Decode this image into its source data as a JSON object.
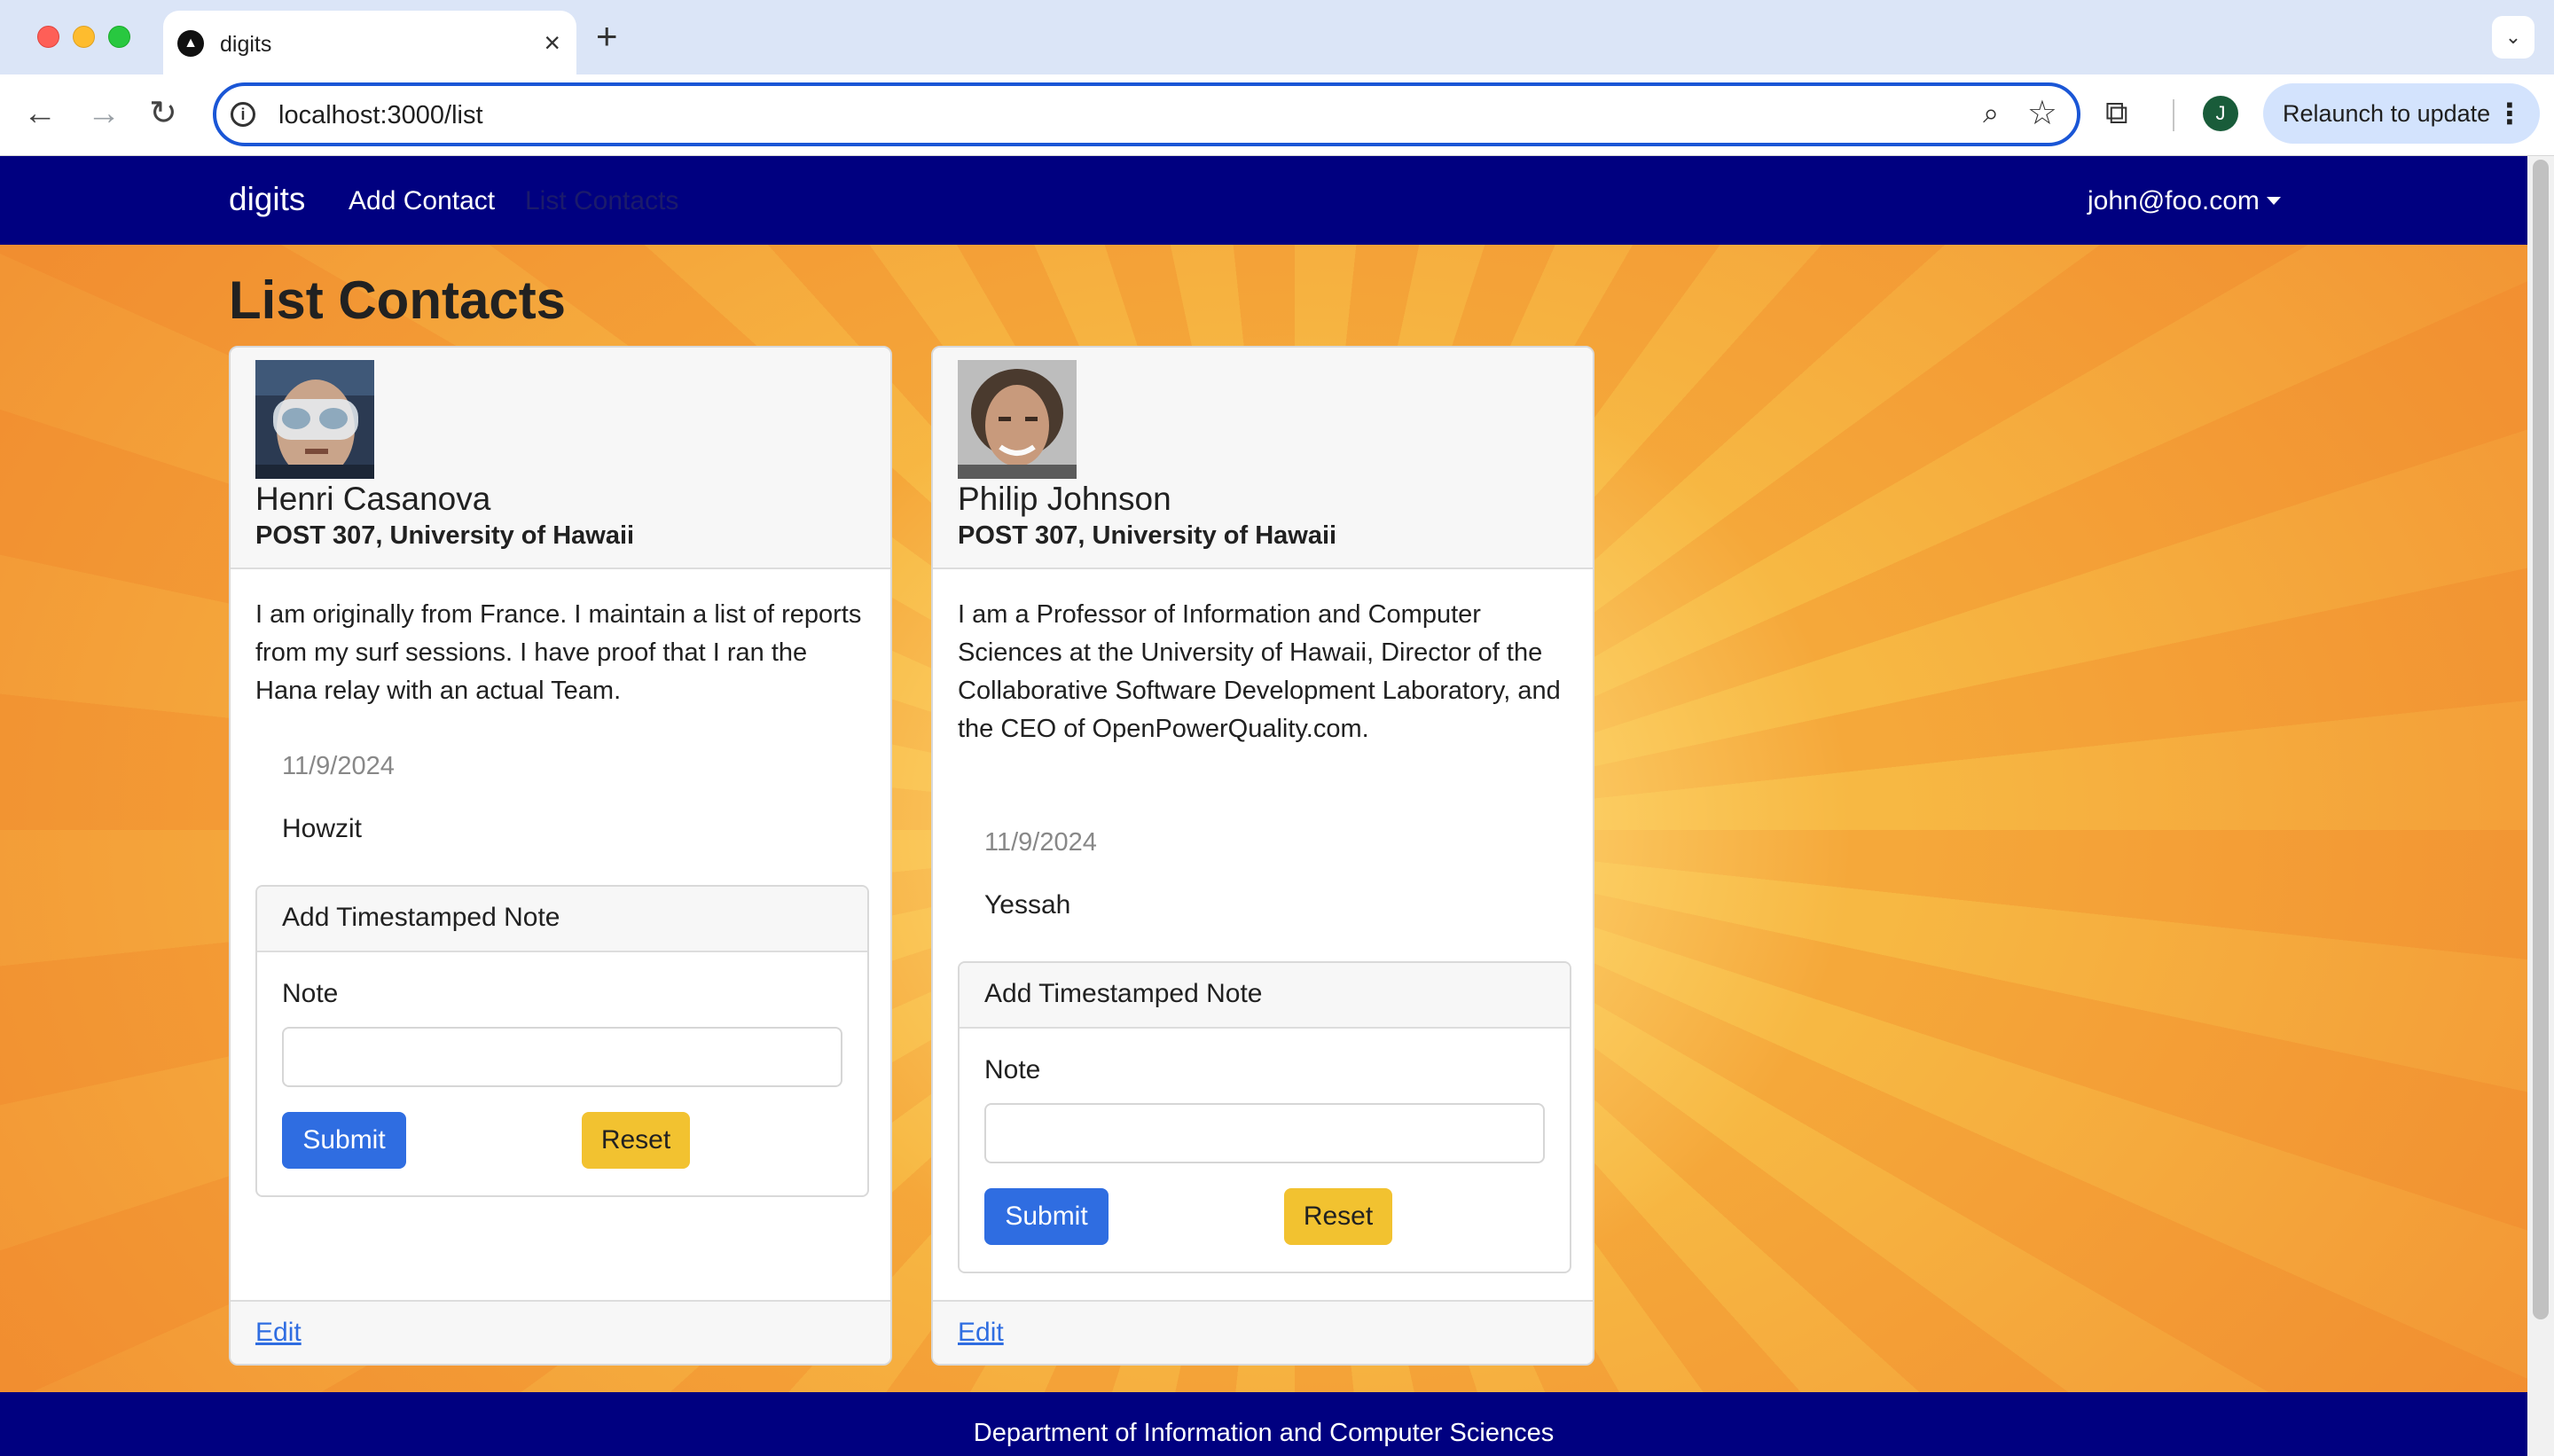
{
  "browser": {
    "tab_title": "digits",
    "url": "localhost:3000/list",
    "profile_initial": "J",
    "relaunch_label": "Relaunch to update"
  },
  "app": {
    "brand": "digits",
    "nav_add_contact": "Add Contact",
    "nav_list_contacts": "List Contacts",
    "user_email": "john@foo.com"
  },
  "page": {
    "title": "List Contacts"
  },
  "contacts": [
    {
      "name": "Henri Casanova",
      "address": "POST 307, University of Hawaii",
      "description": "I am originally from France. I maintain a list of reports from my surf sessions. I have proof that I ran the Hana relay with an actual Team.",
      "notes": [
        {
          "date": "11/9/2024",
          "text": "Howzit"
        }
      ],
      "note_form": {
        "header": "Add Timestamped Note",
        "label": "Note",
        "value": "",
        "submit_label": "Submit",
        "reset_label": "Reset"
      },
      "edit_label": "Edit"
    },
    {
      "name": "Philip Johnson",
      "address": "POST 307, University of Hawaii",
      "description": "I am a Professor of Information and Computer Sciences at the University of Hawaii, Director of the Collaborative Software Development Laboratory, and the CEO of OpenPowerQuality.com.",
      "notes": [
        {
          "date": "11/9/2024",
          "text": "Yessah"
        }
      ],
      "note_form": {
        "header": "Add Timestamped Note",
        "label": "Note",
        "value": "",
        "submit_label": "Submit",
        "reset_label": "Reset"
      },
      "edit_label": "Edit"
    }
  ],
  "footer": {
    "text": "Department of Information and Computer Sciences"
  },
  "colors": {
    "navbar": "#000080",
    "submit": "#2f6de1",
    "reset": "#f2c230",
    "background_orange": "#f4a03a"
  }
}
